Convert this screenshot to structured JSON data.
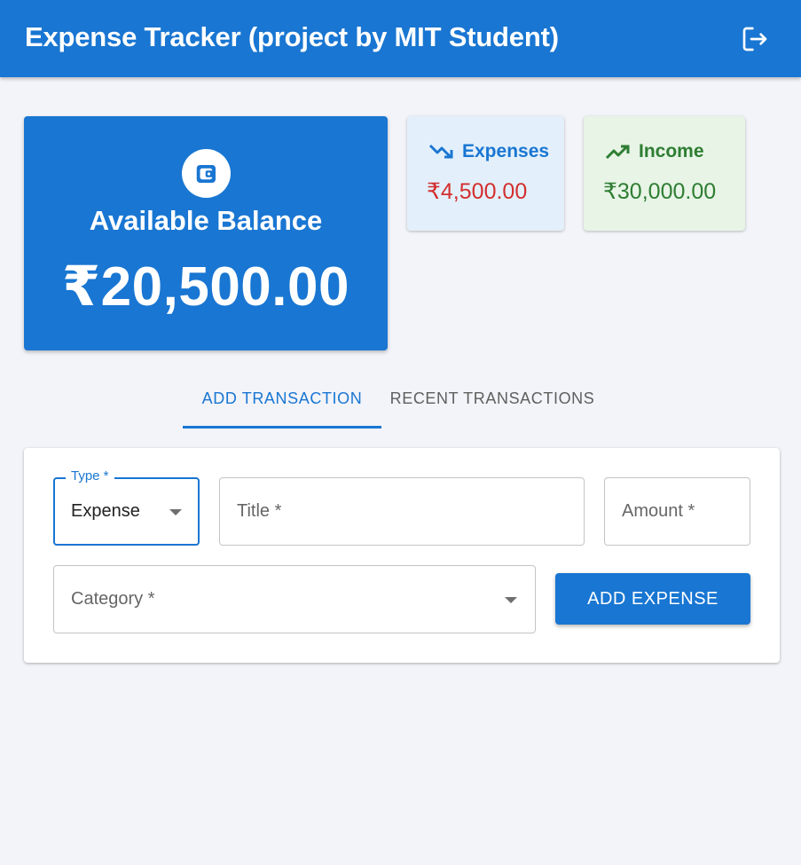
{
  "header": {
    "title": "Expense Tracker (project by MIT Student)",
    "logout_icon": "logout-icon"
  },
  "balance": {
    "icon": "wallet-icon",
    "label": "Available Balance",
    "amount": "₹20,500.00"
  },
  "stats": {
    "expenses": {
      "icon": "trending-down-icon",
      "label": "Expenses",
      "value": "₹4,500.00"
    },
    "income": {
      "icon": "trending-up-icon",
      "label": "Income",
      "value": "₹30,000.00"
    }
  },
  "tabs": [
    {
      "label": "ADD TRANSACTION",
      "active": true
    },
    {
      "label": "RECENT TRANSACTIONS",
      "active": false
    }
  ],
  "form": {
    "type": {
      "label": "Type *",
      "value": "Expense"
    },
    "title": {
      "placeholder": "Title *"
    },
    "amount": {
      "placeholder": "Amount *"
    },
    "category": {
      "placeholder": "Category *"
    },
    "submit_label": "ADD EXPENSE"
  },
  "colors": {
    "primary": "#1976d2",
    "expense_value": "#d32f2f",
    "income": "#2e7d32",
    "background": "#f3f4f9"
  }
}
